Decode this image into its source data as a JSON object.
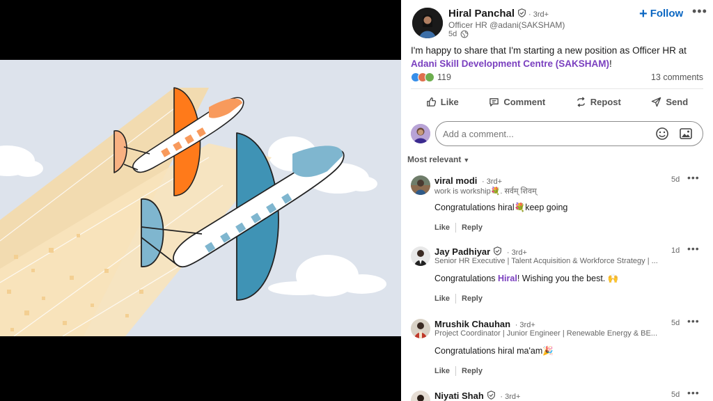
{
  "post": {
    "author": {
      "name": "Hiral Panchal",
      "degree": "· 3rd+",
      "headline": "Officer HR @adani(SAKSHAM)",
      "time": "5d"
    },
    "follow_label": "Follow",
    "follow_plus": "+",
    "more_icon": "•••",
    "text_before": "I'm happy to share that I'm starting a new position as Officer HR at ",
    "company_link": "Adani Skill Development Centre (SAKSHAM)",
    "text_after": "!",
    "reactions_count": "119",
    "comments_count": "13 comments"
  },
  "actions": {
    "like": "Like",
    "comment": "Comment",
    "repost": "Repost",
    "send": "Send"
  },
  "comment_box": {
    "placeholder": "Add a comment..."
  },
  "sort_label": "Most relevant",
  "comments": [
    {
      "name": "viral modi",
      "degree": "· 3rd+",
      "headline": "work is workship💐. सर्वम् शिवम्",
      "time": "5d",
      "text": "Congratulations hiral💐keep going",
      "like": "Like",
      "reply": "Reply"
    },
    {
      "name": "Jay Padhiyar",
      "degree": "· 3rd+",
      "headline": "Senior HR Executive | Talent Acquisition & Workforce Strategy | ...",
      "time": "1d",
      "text_before": "Congratulations ",
      "mention": "Hiral",
      "text_after": "! Wishing you the best. 🙌",
      "like": "Like",
      "reply": "Reply"
    },
    {
      "name": "Mrushik Chauhan",
      "degree": "· 3rd+",
      "headline": "Project Coordinator | Junior Engineer | Renewable Energy & BE...",
      "time": "5d",
      "text": "Congratulations hiral ma'am🎉",
      "like": "Like",
      "reply": "Reply"
    },
    {
      "name": "Niyati Shah",
      "degree": "· 3rd+",
      "time": "5d"
    }
  ],
  "colors": {
    "link_blue": "#0a66c2",
    "mention_purple": "#7a3fbf",
    "plane_orange": "#ff7a1a",
    "plane_blue": "#3f93b5",
    "sky": "#dde3ec"
  }
}
